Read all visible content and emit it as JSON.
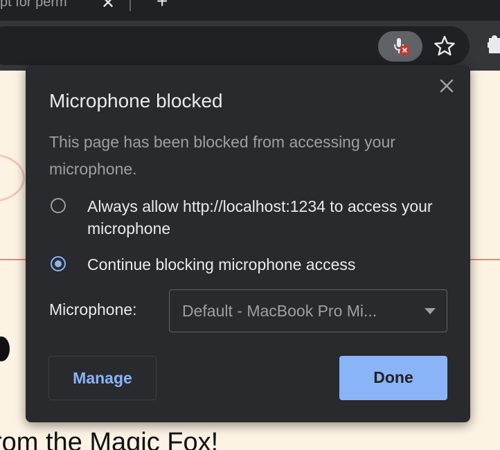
{
  "tab": {
    "title": "pt for perm",
    "close_glyph": "✕",
    "new_tab_glyph": "+"
  },
  "toolbar": {
    "mic_blocked_icon": "microphone-blocked-icon",
    "bookmark_icon": "star-icon",
    "extensions_icon": "puzzle-icon"
  },
  "page": {
    "heading_fragment": "rom the Magic Fox!"
  },
  "popup": {
    "title": "Microphone blocked",
    "description": "This page has been blocked from accessing your microphone.",
    "options": [
      {
        "label": "Always allow http://localhost:1234 to access your microphone",
        "checked": false
      },
      {
        "label": "Continue blocking microphone access",
        "checked": true
      }
    ],
    "microphone_label": "Microphone:",
    "microphone_selected": "Default - MacBook Pro Mi...",
    "manage_label": "Manage",
    "done_label": "Done"
  },
  "colors": {
    "popup_bg": "#292a2d",
    "accent": "#8ab4f8",
    "text_primary": "#e8eaed",
    "text_secondary": "#9aa0a6",
    "page_bg": "#fdf3e4"
  }
}
